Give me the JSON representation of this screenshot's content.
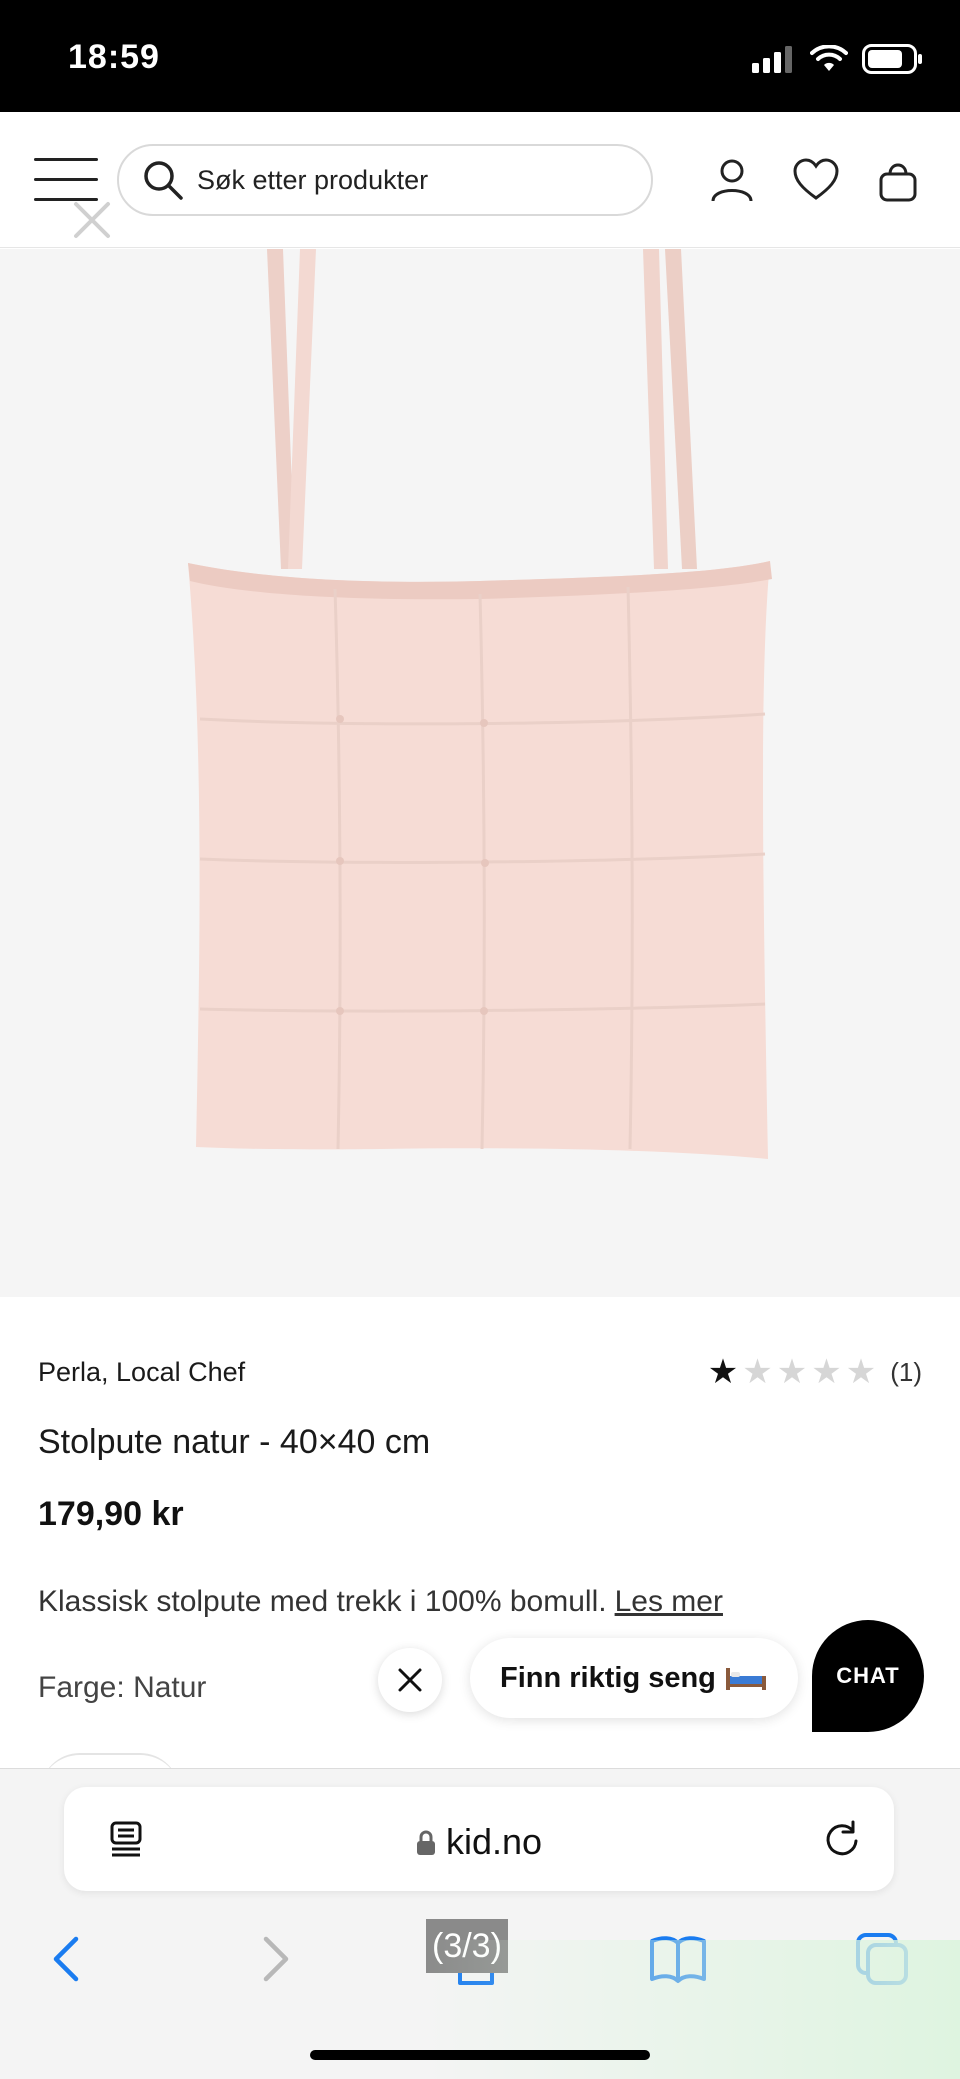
{
  "status_bar": {
    "time": "18:59"
  },
  "header": {
    "search_placeholder": "Søk etter produkter"
  },
  "product": {
    "brand": "Perla, Local Chef",
    "rating": {
      "filled": 1,
      "total": 5,
      "count": "(1)"
    },
    "title": "Stolpute natur - 40×40 cm",
    "price": "179,90 kr",
    "description": "Klassisk stolpute med trekk i 100% bomull.",
    "read_more": "Les mer",
    "color_label": "Farge:",
    "color_value": "Natur",
    "cushion_color": "#f6dcd5"
  },
  "chat": {
    "prompt": "Finn riktig seng",
    "button": "CHAT"
  },
  "browser": {
    "url": "kid.no",
    "page_indicator": "(3/3)"
  },
  "colors": {
    "accent": "#000000",
    "link_blue": "#1a7cf0",
    "image_bg": "#f5f5f5"
  }
}
